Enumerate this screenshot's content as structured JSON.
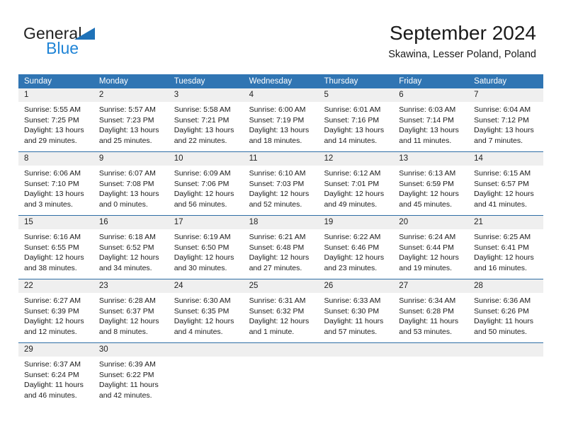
{
  "brand": {
    "name_part1": "General",
    "name_part2": "Blue",
    "triangle_color": "#1f72b8",
    "blue_color": "#1f84d6"
  },
  "header": {
    "title": "September 2024",
    "subtitle": "Skawina, Lesser Poland, Poland"
  },
  "calendar": {
    "header_bg": "#3075b3",
    "day_band_bg": "#efefef",
    "weekdays": [
      "Sunday",
      "Monday",
      "Tuesday",
      "Wednesday",
      "Thursday",
      "Friday",
      "Saturday"
    ],
    "weeks": [
      [
        {
          "day": "1",
          "sunrise": "Sunrise: 5:55 AM",
          "sunset": "Sunset: 7:25 PM",
          "daylight1": "Daylight: 13 hours",
          "daylight2": "and 29 minutes."
        },
        {
          "day": "2",
          "sunrise": "Sunrise: 5:57 AM",
          "sunset": "Sunset: 7:23 PM",
          "daylight1": "Daylight: 13 hours",
          "daylight2": "and 25 minutes."
        },
        {
          "day": "3",
          "sunrise": "Sunrise: 5:58 AM",
          "sunset": "Sunset: 7:21 PM",
          "daylight1": "Daylight: 13 hours",
          "daylight2": "and 22 minutes."
        },
        {
          "day": "4",
          "sunrise": "Sunrise: 6:00 AM",
          "sunset": "Sunset: 7:19 PM",
          "daylight1": "Daylight: 13 hours",
          "daylight2": "and 18 minutes."
        },
        {
          "day": "5",
          "sunrise": "Sunrise: 6:01 AM",
          "sunset": "Sunset: 7:16 PM",
          "daylight1": "Daylight: 13 hours",
          "daylight2": "and 14 minutes."
        },
        {
          "day": "6",
          "sunrise": "Sunrise: 6:03 AM",
          "sunset": "Sunset: 7:14 PM",
          "daylight1": "Daylight: 13 hours",
          "daylight2": "and 11 minutes."
        },
        {
          "day": "7",
          "sunrise": "Sunrise: 6:04 AM",
          "sunset": "Sunset: 7:12 PM",
          "daylight1": "Daylight: 13 hours",
          "daylight2": "and 7 minutes."
        }
      ],
      [
        {
          "day": "8",
          "sunrise": "Sunrise: 6:06 AM",
          "sunset": "Sunset: 7:10 PM",
          "daylight1": "Daylight: 13 hours",
          "daylight2": "and 3 minutes."
        },
        {
          "day": "9",
          "sunrise": "Sunrise: 6:07 AM",
          "sunset": "Sunset: 7:08 PM",
          "daylight1": "Daylight: 13 hours",
          "daylight2": "and 0 minutes."
        },
        {
          "day": "10",
          "sunrise": "Sunrise: 6:09 AM",
          "sunset": "Sunset: 7:06 PM",
          "daylight1": "Daylight: 12 hours",
          "daylight2": "and 56 minutes."
        },
        {
          "day": "11",
          "sunrise": "Sunrise: 6:10 AM",
          "sunset": "Sunset: 7:03 PM",
          "daylight1": "Daylight: 12 hours",
          "daylight2": "and 52 minutes."
        },
        {
          "day": "12",
          "sunrise": "Sunrise: 6:12 AM",
          "sunset": "Sunset: 7:01 PM",
          "daylight1": "Daylight: 12 hours",
          "daylight2": "and 49 minutes."
        },
        {
          "day": "13",
          "sunrise": "Sunrise: 6:13 AM",
          "sunset": "Sunset: 6:59 PM",
          "daylight1": "Daylight: 12 hours",
          "daylight2": "and 45 minutes."
        },
        {
          "day": "14",
          "sunrise": "Sunrise: 6:15 AM",
          "sunset": "Sunset: 6:57 PM",
          "daylight1": "Daylight: 12 hours",
          "daylight2": "and 41 minutes."
        }
      ],
      [
        {
          "day": "15",
          "sunrise": "Sunrise: 6:16 AM",
          "sunset": "Sunset: 6:55 PM",
          "daylight1": "Daylight: 12 hours",
          "daylight2": "and 38 minutes."
        },
        {
          "day": "16",
          "sunrise": "Sunrise: 6:18 AM",
          "sunset": "Sunset: 6:52 PM",
          "daylight1": "Daylight: 12 hours",
          "daylight2": "and 34 minutes."
        },
        {
          "day": "17",
          "sunrise": "Sunrise: 6:19 AM",
          "sunset": "Sunset: 6:50 PM",
          "daylight1": "Daylight: 12 hours",
          "daylight2": "and 30 minutes."
        },
        {
          "day": "18",
          "sunrise": "Sunrise: 6:21 AM",
          "sunset": "Sunset: 6:48 PM",
          "daylight1": "Daylight: 12 hours",
          "daylight2": "and 27 minutes."
        },
        {
          "day": "19",
          "sunrise": "Sunrise: 6:22 AM",
          "sunset": "Sunset: 6:46 PM",
          "daylight1": "Daylight: 12 hours",
          "daylight2": "and 23 minutes."
        },
        {
          "day": "20",
          "sunrise": "Sunrise: 6:24 AM",
          "sunset": "Sunset: 6:44 PM",
          "daylight1": "Daylight: 12 hours",
          "daylight2": "and 19 minutes."
        },
        {
          "day": "21",
          "sunrise": "Sunrise: 6:25 AM",
          "sunset": "Sunset: 6:41 PM",
          "daylight1": "Daylight: 12 hours",
          "daylight2": "and 16 minutes."
        }
      ],
      [
        {
          "day": "22",
          "sunrise": "Sunrise: 6:27 AM",
          "sunset": "Sunset: 6:39 PM",
          "daylight1": "Daylight: 12 hours",
          "daylight2": "and 12 minutes."
        },
        {
          "day": "23",
          "sunrise": "Sunrise: 6:28 AM",
          "sunset": "Sunset: 6:37 PM",
          "daylight1": "Daylight: 12 hours",
          "daylight2": "and 8 minutes."
        },
        {
          "day": "24",
          "sunrise": "Sunrise: 6:30 AM",
          "sunset": "Sunset: 6:35 PM",
          "daylight1": "Daylight: 12 hours",
          "daylight2": "and 4 minutes."
        },
        {
          "day": "25",
          "sunrise": "Sunrise: 6:31 AM",
          "sunset": "Sunset: 6:32 PM",
          "daylight1": "Daylight: 12 hours",
          "daylight2": "and 1 minute."
        },
        {
          "day": "26",
          "sunrise": "Sunrise: 6:33 AM",
          "sunset": "Sunset: 6:30 PM",
          "daylight1": "Daylight: 11 hours",
          "daylight2": "and 57 minutes."
        },
        {
          "day": "27",
          "sunrise": "Sunrise: 6:34 AM",
          "sunset": "Sunset: 6:28 PM",
          "daylight1": "Daylight: 11 hours",
          "daylight2": "and 53 minutes."
        },
        {
          "day": "28",
          "sunrise": "Sunrise: 6:36 AM",
          "sunset": "Sunset: 6:26 PM",
          "daylight1": "Daylight: 11 hours",
          "daylight2": "and 50 minutes."
        }
      ],
      [
        {
          "day": "29",
          "sunrise": "Sunrise: 6:37 AM",
          "sunset": "Sunset: 6:24 PM",
          "daylight1": "Daylight: 11 hours",
          "daylight2": "and 46 minutes."
        },
        {
          "day": "30",
          "sunrise": "Sunrise: 6:39 AM",
          "sunset": "Sunset: 6:22 PM",
          "daylight1": "Daylight: 11 hours",
          "daylight2": "and 42 minutes."
        },
        {
          "day": "",
          "sunrise": "",
          "sunset": "",
          "daylight1": "",
          "daylight2": ""
        },
        {
          "day": "",
          "sunrise": "",
          "sunset": "",
          "daylight1": "",
          "daylight2": ""
        },
        {
          "day": "",
          "sunrise": "",
          "sunset": "",
          "daylight1": "",
          "daylight2": ""
        },
        {
          "day": "",
          "sunrise": "",
          "sunset": "",
          "daylight1": "",
          "daylight2": ""
        },
        {
          "day": "",
          "sunrise": "",
          "sunset": "",
          "daylight1": "",
          "daylight2": ""
        }
      ]
    ]
  }
}
